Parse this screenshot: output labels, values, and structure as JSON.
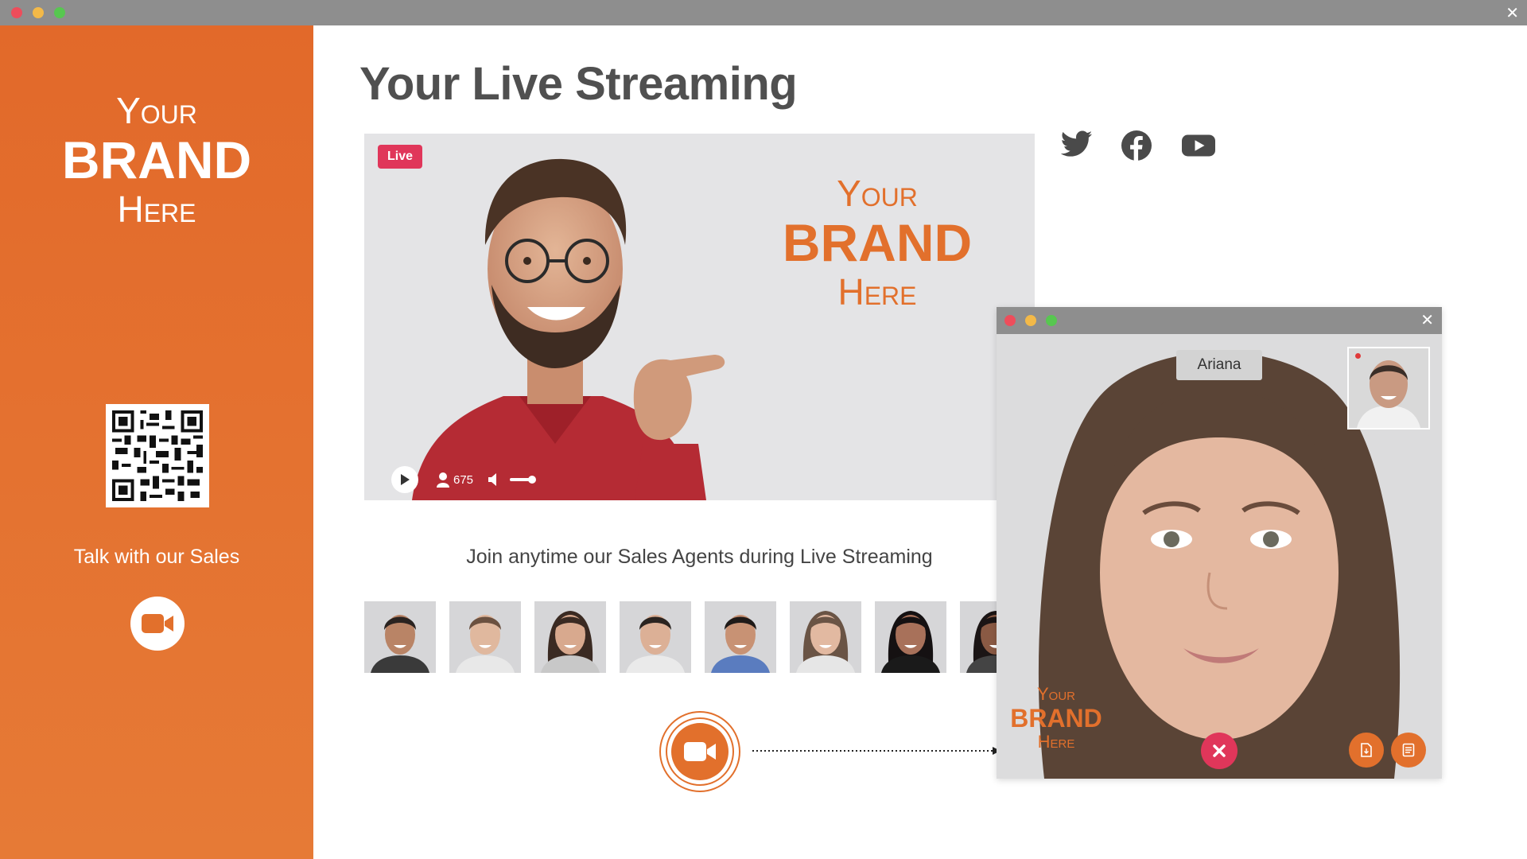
{
  "window": {
    "close_glyph": "✕",
    "dots": [
      "#ee4d5b",
      "#f3b948",
      "#57c750"
    ]
  },
  "sidebar": {
    "brand": {
      "top": "Your",
      "middle": "BRAND",
      "bottom": "Here"
    },
    "talk_label": "Talk with our Sales",
    "video_icon": "video-camera-icon",
    "qr_icon": "qr-code-icon"
  },
  "main": {
    "title": "Your Live Streaming",
    "video": {
      "live_label": "Live",
      "brand": {
        "top": "Your",
        "middle": "BRAND",
        "bottom": "Here"
      },
      "viewer_count": "675",
      "icons": [
        "play-icon",
        "viewers-icon",
        "volume-icon"
      ]
    },
    "social_icons": [
      "twitter-icon",
      "facebook-icon",
      "youtube-icon"
    ],
    "caption": "Join anytime our Sales Agents during Live Streaming",
    "agents": [
      {
        "name": "agent-1"
      },
      {
        "name": "agent-2"
      },
      {
        "name": "agent-3"
      },
      {
        "name": "agent-4"
      },
      {
        "name": "agent-5"
      },
      {
        "name": "agent-6"
      },
      {
        "name": "agent-7"
      },
      {
        "name": "agent-8"
      }
    ]
  },
  "call_window": {
    "caller_name": "Ariana",
    "close_glyph": "✕",
    "brand": {
      "top": "Your",
      "middle": "BRAND",
      "bottom": "Here"
    },
    "end_call_icon": "close-icon",
    "action_icons": [
      "document-icon",
      "notes-icon"
    ]
  },
  "colors": {
    "brand_orange": "#e2702c",
    "live_red": "#e0365a",
    "titlebar_gray": "#8e8e8e"
  }
}
